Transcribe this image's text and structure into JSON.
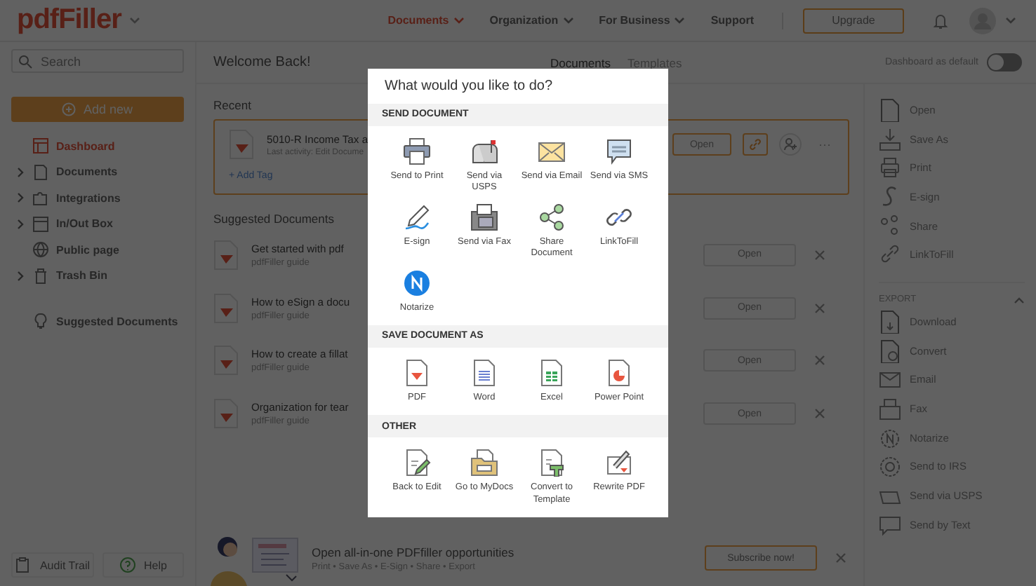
{
  "header": {
    "logo": "pdfFiller",
    "nav": [
      {
        "label": "Documents",
        "selected": true
      },
      {
        "label": "Organization",
        "selected": false
      },
      {
        "label": "For Business",
        "selected": false
      },
      {
        "label": "Support",
        "selected": false
      }
    ],
    "upgrade": "Upgrade"
  },
  "sidebar": {
    "search_placeholder": "Search",
    "add_new": "Add new",
    "items": [
      {
        "label": "Dashboard",
        "selected": true,
        "kind": "link"
      },
      {
        "label": "Documents",
        "selected": false,
        "kind": "group"
      },
      {
        "label": "Integrations",
        "selected": false,
        "kind": "group"
      },
      {
        "label": "In/Out Box",
        "selected": false,
        "kind": "group"
      },
      {
        "label": "Public page",
        "selected": false,
        "kind": "link"
      },
      {
        "label": "Trash Bin",
        "selected": false,
        "kind": "group"
      }
    ],
    "suggested": "Suggested Documents",
    "footer": [
      "Audit Trail",
      "Help"
    ]
  },
  "main": {
    "greeting": "Welcome Back!",
    "tabs": [
      {
        "label": "Documents",
        "selected": true
      },
      {
        "label": "Templates",
        "selected": false
      }
    ],
    "toggle": {
      "label": "Dashboard as default",
      "on": false
    },
    "recent": {
      "heading": "Recent",
      "title": "5010-R Income Tax a",
      "activity": "Last activity: Edit Docume",
      "tag": "+ Add Tag",
      "open": "Open",
      "more": "···"
    },
    "suggested": {
      "heading": "Suggested Documents",
      "items": [
        {
          "title": "Get started with pdf",
          "subtitle": "pdfFiller guide",
          "open": "Open"
        },
        {
          "title": "How to eSign a docu",
          "subtitle": "pdfFiller guide",
          "open": "Open"
        },
        {
          "title": "How to create a fillat",
          "subtitle": "pdfFiller guide",
          "open": "Open"
        },
        {
          "title": "Organization for tear",
          "subtitle": "pdfFiller guide",
          "open": "Open"
        }
      ]
    },
    "banner": {
      "title": "Open all-in-one PDFfiller opportunities",
      "subtitle": "Print • Save As • E-Sign • Share • Export",
      "button": "Subscribe now!"
    }
  },
  "right_panel": {
    "actions": [
      "Open",
      "Save As",
      "Print",
      "E-sign",
      "Share",
      "LinkToFill"
    ],
    "export": {
      "heading": "EXPORT",
      "expanded": true,
      "items": [
        "Download",
        "Convert",
        "Email",
        "Fax",
        "Notarize",
        "Send to IRS",
        "Send via USPS",
        "Send by Text"
      ]
    }
  },
  "dialog": {
    "title": "What would you like to do?",
    "sections": [
      {
        "heading": "SEND DOCUMENT",
        "items": [
          "Send to Print",
          "Send via USPS",
          "Send via Email",
          "Send via SMS",
          "E-sign",
          "Send via Fax",
          "Share Document",
          "LinkToFill",
          "Notarize"
        ]
      },
      {
        "heading": "SAVE DOCUMENT AS",
        "items": [
          "PDF",
          "Word",
          "Excel",
          "Power Point"
        ]
      },
      {
        "heading": "OTHER",
        "items": [
          "Back to Edit",
          "Go to MyDocs",
          "Convert to Template",
          "Rewrite PDF"
        ]
      }
    ]
  }
}
